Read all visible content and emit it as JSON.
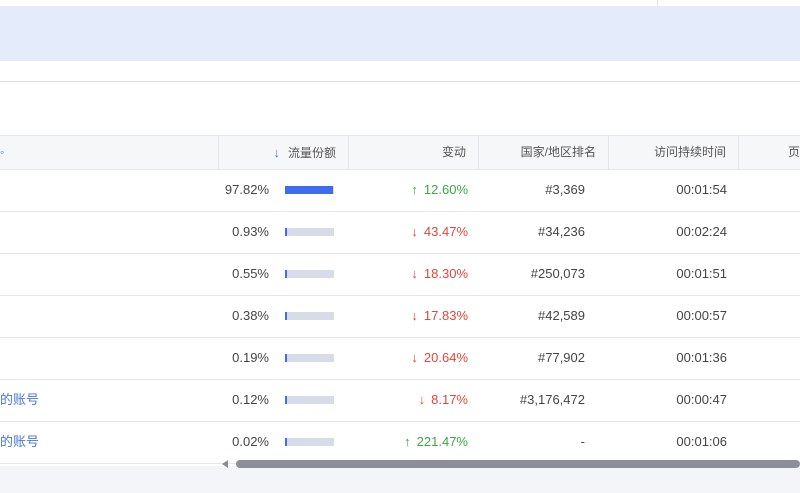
{
  "colors": {
    "banner": "#e4ebfb",
    "accent": "#3d6ef0",
    "up": "#3aa843",
    "down": "#e5453a",
    "link": "#4a78d6"
  },
  "table": {
    "columns": {
      "share": "流量份额",
      "change": "变动",
      "rank": "国家/地区排名",
      "duration": "访问持续时间",
      "partial": "页"
    },
    "sort_icon": "arrow-down-icon",
    "rows": [
      {
        "name": "",
        "share": "97.82%",
        "share_value": 0.9782,
        "change": "12.60%",
        "direction": "up",
        "rank": "#3,369",
        "duration": "00:01:54"
      },
      {
        "name": "",
        "share": "0.93%",
        "share_value": 0.0093,
        "change": "43.47%",
        "direction": "down",
        "rank": "#34,236",
        "duration": "00:02:24"
      },
      {
        "name": "",
        "share": "0.55%",
        "share_value": 0.0055,
        "change": "18.30%",
        "direction": "down",
        "rank": "#250,073",
        "duration": "00:01:51"
      },
      {
        "name": "",
        "share": "0.38%",
        "share_value": 0.0038,
        "change": "17.83%",
        "direction": "down",
        "rank": "#42,589",
        "duration": "00:00:57"
      },
      {
        "name": "",
        "share": "0.19%",
        "share_value": 0.0019,
        "change": "20.64%",
        "direction": "down",
        "rank": "#77,902",
        "duration": "00:01:36"
      },
      {
        "name": "的账号",
        "share": "0.12%",
        "share_value": 0.0012,
        "change": "8.17%",
        "direction": "down",
        "rank": "#3,176,472",
        "duration": "00:00:47"
      },
      {
        "name": "的账号",
        "share": "0.02%",
        "share_value": 0.0002,
        "change": "221.47%",
        "direction": "up",
        "rank": "-",
        "duration": "00:01:06"
      }
    ]
  },
  "arrows": {
    "up": "↑",
    "down": "↓",
    "sort": "↓"
  }
}
